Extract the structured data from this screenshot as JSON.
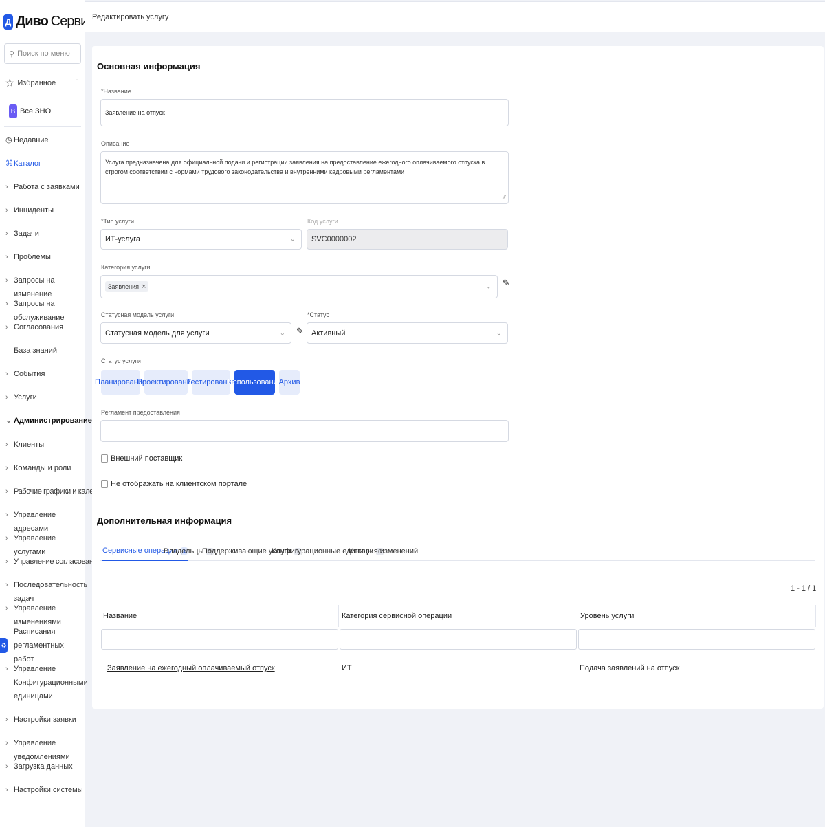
{
  "brand": {
    "mark": "Д",
    "bold": "Диво",
    "thin": "Сервис"
  },
  "sidebar": {
    "search_placeholder": "Поиск по меню",
    "favorites": "Избранное",
    "all_zno_badge": "В",
    "all_zno": "Все ЗНО",
    "items": [
      {
        "label": "Недавние"
      },
      {
        "label": "Каталог"
      },
      {
        "label": "Работа с заявками"
      },
      {
        "label": "Инциденты"
      },
      {
        "label": "Задачи"
      },
      {
        "label": "Проблемы"
      },
      {
        "label": "Запросы на изменение"
      },
      {
        "label": "Запросы на обслуживание"
      },
      {
        "label": "Согласования"
      },
      {
        "label": "База знаний"
      },
      {
        "label": "События"
      },
      {
        "label": "Услуги"
      },
      {
        "label": "Администрирование"
      },
      {
        "label": "Клиенты"
      },
      {
        "label": "Команды и роли"
      },
      {
        "label": "Рабочие графики и календари"
      },
      {
        "label": "Управление адресами"
      },
      {
        "label": "Управление услугами"
      },
      {
        "label": "Управление согласованиями"
      },
      {
        "label": "Последовательность задач"
      },
      {
        "label": "Управление изменениями"
      },
      {
        "label": "Расписания регламентных работ"
      },
      {
        "label": "Управление Конфигурационными единицами"
      },
      {
        "label": "Настройки заявки"
      },
      {
        "label": "Управление уведомлениями"
      },
      {
        "label": "Загрузка данных"
      },
      {
        "label": "Настройки системы"
      }
    ]
  },
  "header": {
    "title": "Редактировать услугу"
  },
  "main": {
    "section_title": "Основная информация",
    "name_label": "*Название",
    "name_value": "Заявление на отпуск",
    "description_label": "Описание",
    "description_value": "Услуга предназначена для официальной подачи и регистрации заявления на предоставление ежегодного оплачиваемого отпуска в строгом соответствии с нормами трудового законодательства и внутренними кадровыми регламентами",
    "type_label": "*Тип услуги",
    "type_value": "ИТ-услуга",
    "code_label": "Код услуги",
    "code_value": "SVC0000002",
    "category_label": "Категория услуги",
    "category_chip": "Заявления",
    "status_model_label": "Статусная модель услуги",
    "status_model_value": "Статусная модель для услуги",
    "status_label": "*Статус",
    "status_value": "Активный",
    "service_status_label": "Статус услуги",
    "stages": [
      "Планирование",
      "Проектирование",
      "Тестирование",
      "Использование",
      "Архив"
    ],
    "active_stage": "Использование",
    "regulation_label": "Регламент предоставления",
    "regulation_value": "",
    "external_supplier": "Внешний поставщик",
    "hide_on_portal": "Не отображать на клиентском портале"
  },
  "additional": {
    "title": "Дополнительная информация",
    "tabs": [
      {
        "label": "Сервисные операции",
        "count": "1"
      },
      {
        "label": "Владельцы",
        "count": "2"
      },
      {
        "label": "Поддерживающие услуги",
        "count": "1"
      },
      {
        "label": "Конфигурационные единицы",
        "count": "0"
      },
      {
        "label": "История изменений",
        "count": ""
      }
    ],
    "pager": "1 - 1 / 1",
    "columns": [
      "Название",
      "Категория сервисной операции",
      "Уровень услуги"
    ],
    "rows": [
      [
        "Заявление на ежегодный оплачиваемый отпуск",
        "ИТ",
        "Подача заявлений на отпуск"
      ]
    ]
  },
  "colors": {
    "accent": "#2259e6",
    "badge": "#6a5cf4",
    "background": "#f0f2f7"
  }
}
